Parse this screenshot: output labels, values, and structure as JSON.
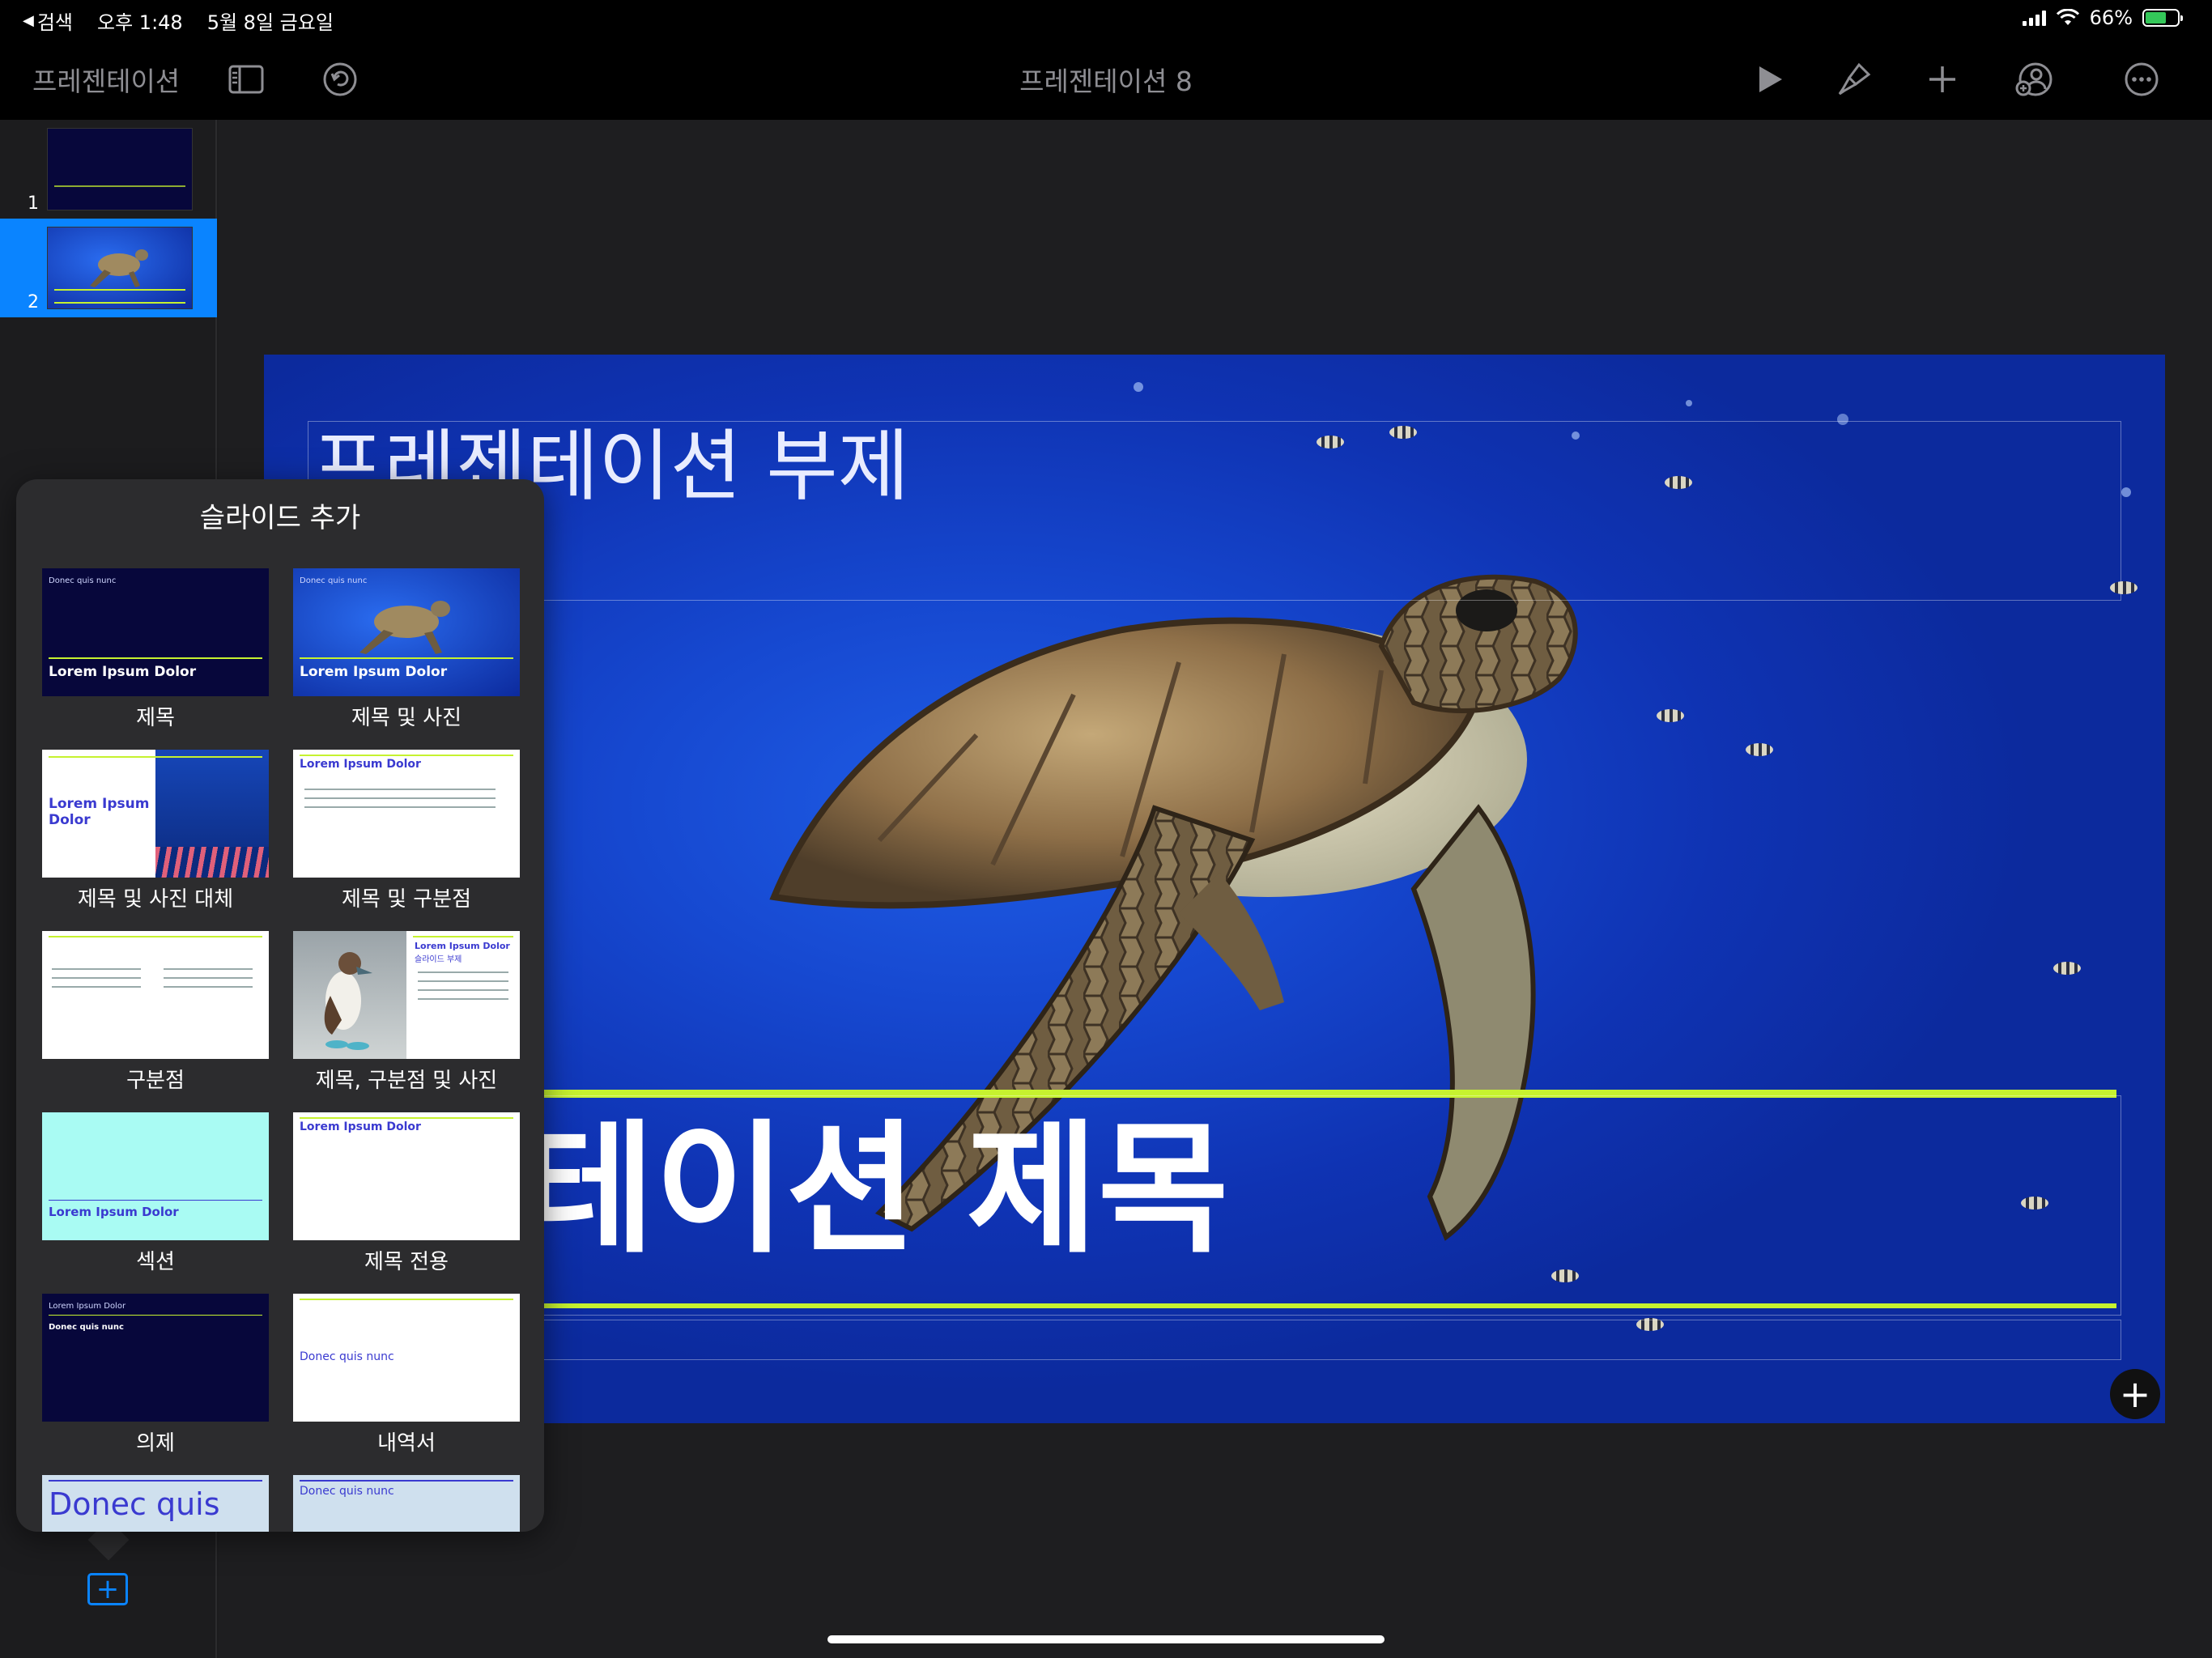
{
  "status_bar": {
    "back_label": "검색",
    "time": "오후 1:48",
    "date": "5월 8일 금요일",
    "battery": "66%",
    "battery_level": 0.66,
    "battery_color": "#34c759"
  },
  "toolbar": {
    "doc_name": "프레젠테이션",
    "title": "프레젠테이션 8",
    "icons": [
      "sidebar-icon",
      "undo-icon",
      "play-icon",
      "paintbrush-icon",
      "plus-icon",
      "collaborate-icon",
      "more-icon"
    ]
  },
  "navigator": {
    "slides": [
      {
        "number": "1"
      },
      {
        "number": "2",
        "selected": true
      }
    ],
    "add_button": "+"
  },
  "slide": {
    "subtitle": "프레젠테이션 부제",
    "title": "프레젠테이션 제목",
    "add_button": "+",
    "accent_color": "#c6f22f"
  },
  "popover": {
    "title": "슬라이드 추가",
    "layouts": [
      {
        "label": "제목",
        "heading": "Lorem Ipsum Dolor",
        "kicker": "Donec quis nunc"
      },
      {
        "label": "제목 및 사진",
        "heading": "Lorem Ipsum Dolor",
        "kicker": "Donec quis nunc"
      },
      {
        "label": "제목 및 사진 대체",
        "heading": "Lorem Ipsum Dolor"
      },
      {
        "label": "제목 및 구분점",
        "heading": "Lorem Ipsum Dolor"
      },
      {
        "label": "구분점"
      },
      {
        "label": "제목, 구분점 및 사진",
        "heading": "Lorem Ipsum Dolor",
        "sub": "슬라이드 부제"
      },
      {
        "label": "섹션",
        "heading": "Lorem Ipsum Dolor"
      },
      {
        "label": "제목 전용",
        "heading": "Lorem Ipsum Dolor"
      },
      {
        "label": "의제",
        "heading": "Lorem Ipsum Dolor",
        "sub": "Donec quis nunc"
      },
      {
        "label": "내역서",
        "heading": "Donec quis nunc"
      },
      {
        "heading": "Donec quis"
      },
      {
        "heading": "Donec quis nunc"
      }
    ]
  }
}
